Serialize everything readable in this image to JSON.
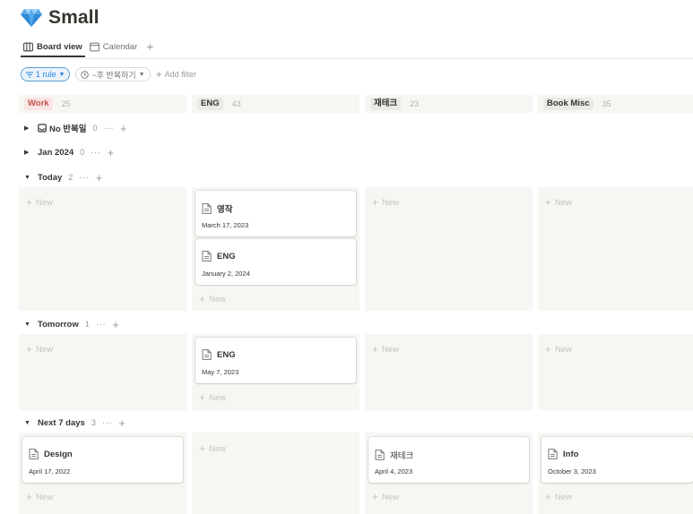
{
  "page": {
    "title": "Small",
    "icon": "gem-icon"
  },
  "views": {
    "items": [
      {
        "label": "Board view",
        "icon": "board-icon",
        "active": true
      },
      {
        "label": "Calendar",
        "icon": "calendar-icon",
        "active": false
      }
    ],
    "add": "+"
  },
  "filters": {
    "rule_label": "1 rule",
    "sort_label": "~후 반복하기",
    "add_filter_label": "Add filter"
  },
  "columns": [
    {
      "name": "Work",
      "count": "25",
      "tag_bg": "#fbe4e4",
      "tag_color": "#c4554d"
    },
    {
      "name": "ENG",
      "count": "43",
      "tag_bg": "#e9e9e7",
      "tag_color": "#37352f"
    },
    {
      "name": "재테크",
      "count": "23",
      "tag_bg": "#e9e9e7",
      "tag_color": "#37352f"
    },
    {
      "name": "Book Misc",
      "count": "35",
      "tag_bg": "#e9e9e7",
      "tag_color": "#37352f"
    }
  ],
  "groups": {
    "no_repeat": {
      "name": "No 반복일",
      "count": "0",
      "collapsed": true
    },
    "jan2024": {
      "name": "Jan 2024",
      "count": "0",
      "collapsed": true
    },
    "today": {
      "name": "Today",
      "count": "2",
      "collapsed": false
    },
    "tomorrow": {
      "name": "Tomorrow",
      "count": "1",
      "collapsed": false
    },
    "next7": {
      "name": "Next 7 days",
      "count": "3",
      "collapsed": false
    }
  },
  "group_actions": {
    "more": "···",
    "add": "+"
  },
  "new_label": "New",
  "cards": {
    "today_eng_1": {
      "title": "영작",
      "date": "March 17, 2023"
    },
    "today_eng_2": {
      "title": "ENG",
      "date": "January 2, 2024"
    },
    "tomorrow_eng_1": {
      "title": "ENG",
      "date": "May 7, 2023"
    },
    "next7_work_1": {
      "title": "Design",
      "date": "April 17, 2022"
    },
    "next7_jaetech_1": {
      "title": "재테크",
      "date": "April 4, 2023"
    },
    "next7_book_1": {
      "title": "Info",
      "date": "October 3, 2023"
    }
  },
  "colors": {
    "accent": "#2383e2",
    "cell_bg": "#f7f6f3",
    "text": "#37352f",
    "muted": "#9b9a97"
  }
}
